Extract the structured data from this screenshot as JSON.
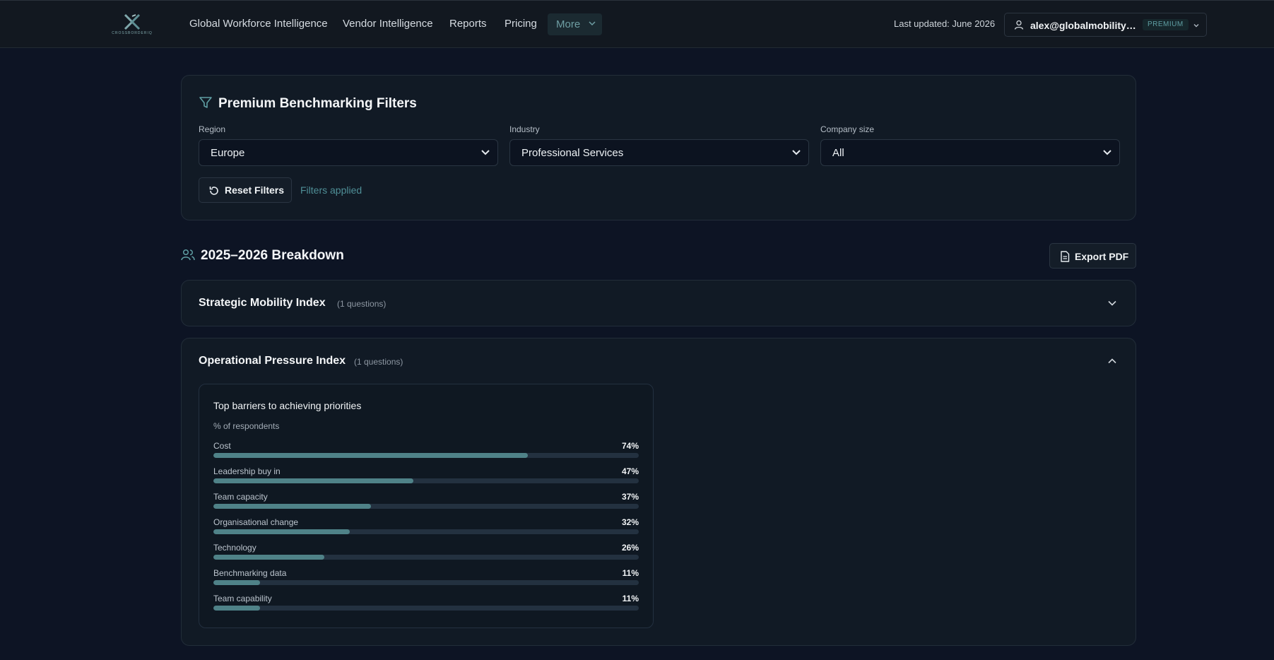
{
  "brand": {
    "logo_text": "CROSSBORDERIQ"
  },
  "nav": {
    "items": [
      "Global Workforce Intelligence",
      "Vendor Intelligence",
      "Reports",
      "Pricing"
    ],
    "more_label": "More"
  },
  "header": {
    "last_updated": "Last updated: June 2026",
    "user_email": "alex@globalmobilityexchange.com",
    "badge": "PREMIUM"
  },
  "filters": {
    "title": "Premium Benchmarking Filters",
    "region": {
      "label": "Region",
      "value": "Europe"
    },
    "industry": {
      "label": "Industry",
      "value": "Professional Services"
    },
    "company_size": {
      "label": "Company size",
      "value": "All"
    },
    "reset_label": "Reset Filters",
    "status": "Filters applied"
  },
  "breakdown": {
    "title": "2025–2026 Breakdown",
    "export_label": "Export PDF"
  },
  "sections": [
    {
      "title": "Strategic Mobility Index",
      "count": "(1 questions)",
      "expanded": false
    },
    {
      "title": "Operational Pressure Index",
      "count": "(1 questions)",
      "expanded": true
    }
  ],
  "colors": {
    "accent": "#4f8288",
    "background": "#0d1424",
    "card": "#111a25",
    "badge_text": "#5f9ea3"
  },
  "chart_data": {
    "type": "bar",
    "title": "Top barriers to achieving priorities",
    "subtitle": "% of respondents",
    "categories": [
      "Cost",
      "Leadership buy in",
      "Team capacity",
      "Organisational change",
      "Technology",
      "Benchmarking data",
      "Team capability"
    ],
    "values": [
      74,
      47,
      37,
      32,
      26,
      11,
      11
    ],
    "value_labels": [
      "74%",
      "47%",
      "37%",
      "32%",
      "26%",
      "11%",
      "11%"
    ],
    "ylim": [
      0,
      100
    ]
  }
}
